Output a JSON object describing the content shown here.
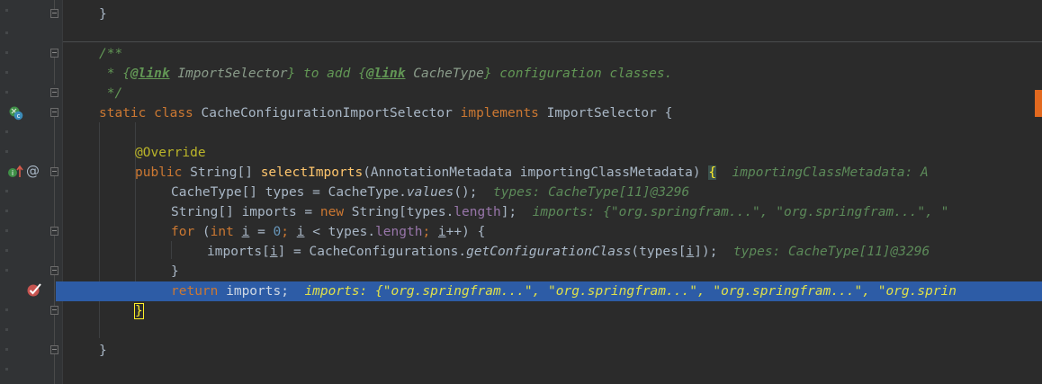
{
  "code": {
    "line_close_prev": "}",
    "doc_open": "/**",
    "doc_line_1": {
      "prefix": " * {",
      "tag_1": "@link",
      "ref_1": "ImportSelector",
      "mid": "} to add {",
      "tag_2": "@link",
      "ref_2": "CacheType",
      "suffix": "} configuration classes."
    },
    "doc_close": " */",
    "class_decl": {
      "kw_static": "static",
      "kw_class": "class",
      "name": "CacheConfigurationImportSelector",
      "kw_implements": "implements",
      "iface": "ImportSelector",
      "brace": "{"
    },
    "annotation": "@Override",
    "method_decl": {
      "kw_public": "public",
      "ret_type": "String[]",
      "name": "selectImports",
      "params": "(AnnotationMetadata importingClassMetadata)",
      "brace": "{",
      "hint": "importingClassMetadata: A"
    },
    "stmt_1": {
      "text_a": "CacheType[] types = CacheType.",
      "call": "values",
      "text_b": "();",
      "hint": "types: CacheType[11]@3296"
    },
    "stmt_2": {
      "text_a": "String[] imports = ",
      "kw_new": "new",
      "text_b": " String[types.",
      "field": "length",
      "text_c": "];",
      "hint": "imports: {\"org.springfram...\", \"org.springfram...\", \""
    },
    "stmt_3": {
      "kw_for": "for",
      "text_a": " (",
      "kw_int": "int",
      "sp": " ",
      "var_i": "i",
      "text_b": " = ",
      "zero": "0",
      "semi": "; ",
      "var_i2": "i",
      "text_c": " < types.",
      "field": "length",
      "semi2": "; ",
      "var_i3": "i",
      "text_d": "++) {"
    },
    "stmt_4": {
      "text_a": "imports[",
      "var_i": "i",
      "text_b": "] = CacheConfigurations.",
      "call": "getConfigurationClass",
      "text_c": "(types[",
      "var_i2": "i",
      "text_d": "]);",
      "hint": "types: CacheType[11]@3296"
    },
    "for_close": "}",
    "return_stmt": {
      "kw_return": "return",
      "text": " imports;",
      "hint": "imports: {\"org.springfram...\", \"org.springfram...\", \"org.springfram...\", \"org.sprin"
    },
    "method_close": "}",
    "class_close": "}"
  },
  "gutter": {
    "class_icon": "class-c-icon",
    "override_icon": "override-up-arrow-icon",
    "at_icon": "annotation-at-icon",
    "at_glyph": "@",
    "breakpoint_icon": "breakpoint-check-icon"
  },
  "colors": {
    "background": "#2b2b2b",
    "gutter": "#313335",
    "highlight": "#2d5ca6",
    "keyword": "#cc7832",
    "method": "#ffc66d",
    "doc": "#629755"
  }
}
